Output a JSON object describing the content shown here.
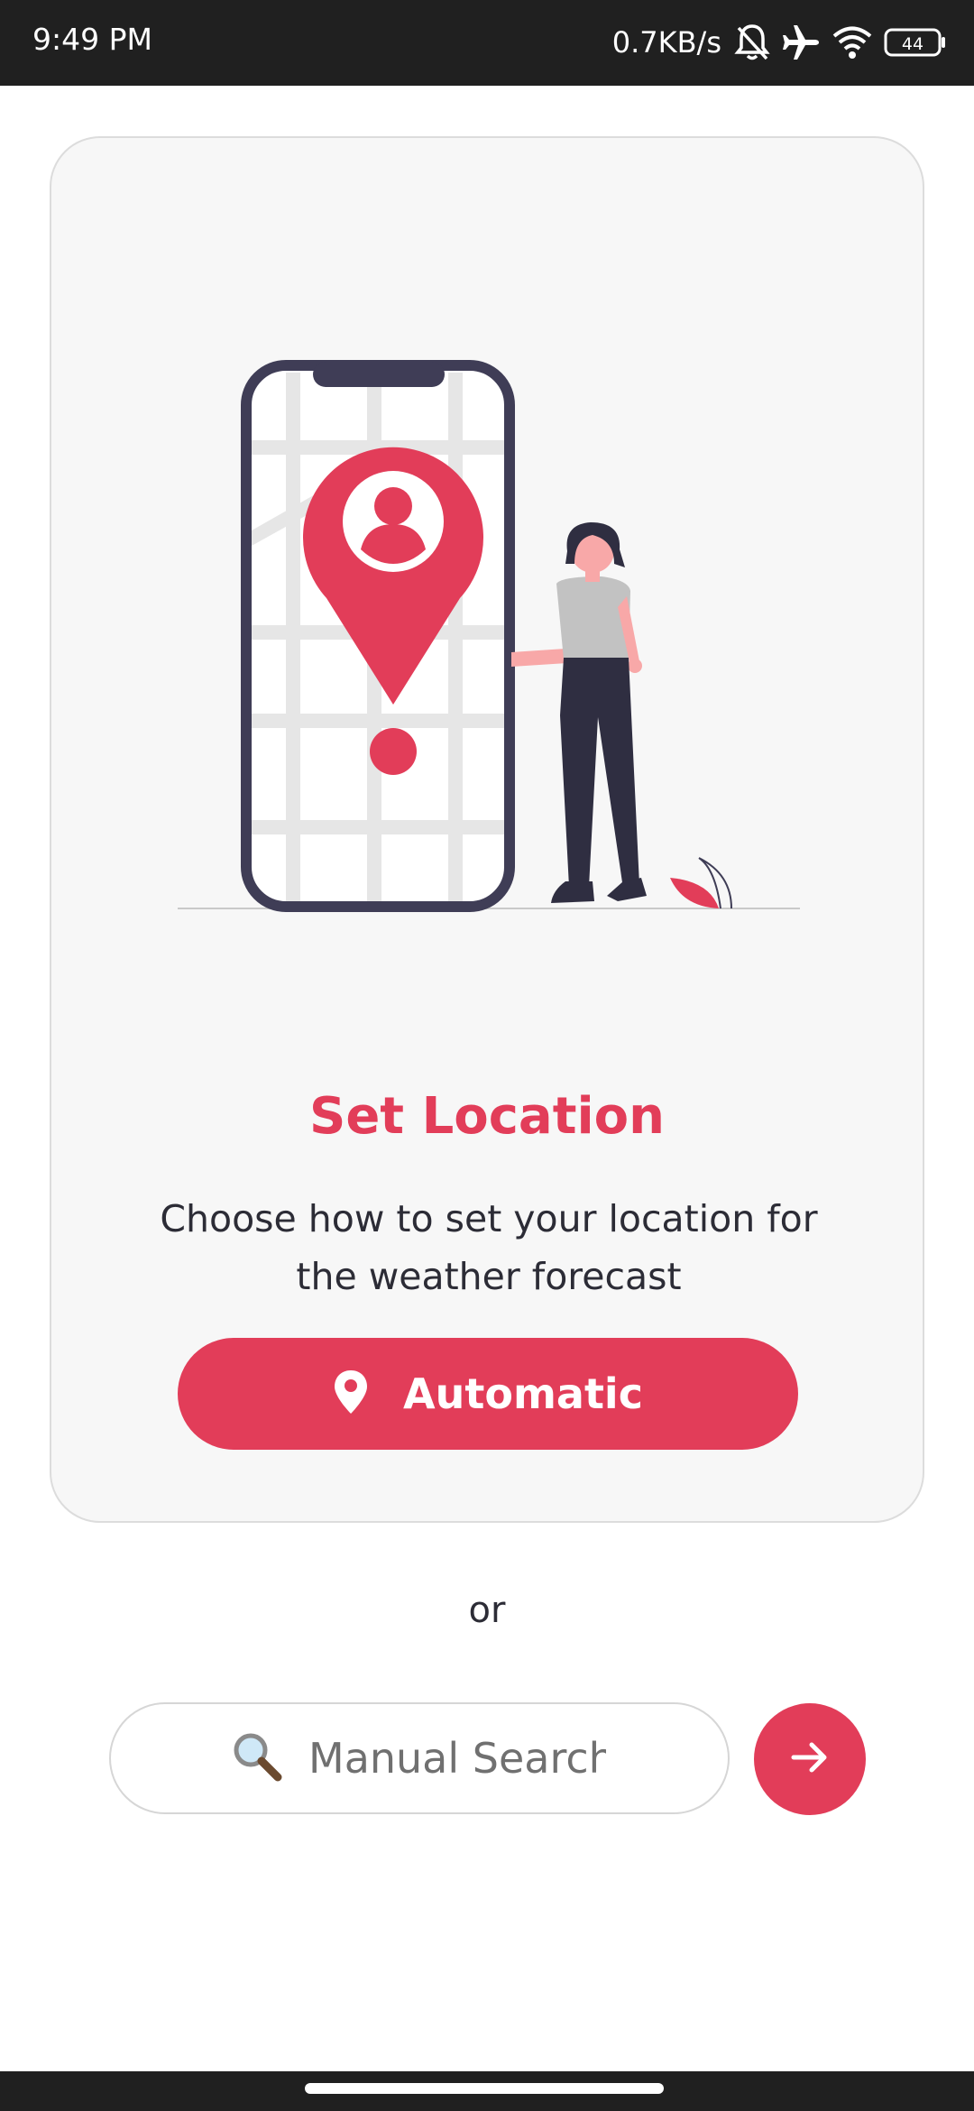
{
  "status_bar": {
    "time": "9:49 PM",
    "network_speed": "0.7KB/s",
    "battery_level": "44",
    "icons": [
      "bell-off-icon",
      "airplane-icon",
      "wifi-icon",
      "battery-icon"
    ]
  },
  "card": {
    "illustration": "person-next-to-phone-map-location-pin",
    "title": "Set Location",
    "description": "Choose how to set your location for the weather forecast",
    "auto_button": {
      "icon": "location-pin-icon",
      "label": "Automatic"
    }
  },
  "divider_text": "or",
  "search": {
    "icon": "magnifier-icon",
    "placeholder": "Manual Search",
    "value": "",
    "submit_icon": "arrow-right-icon"
  },
  "colors": {
    "accent": "#e23d59",
    "text_dark": "#2c2c36",
    "card_bg": "#f7f7f7",
    "system_bar": "#202020"
  }
}
